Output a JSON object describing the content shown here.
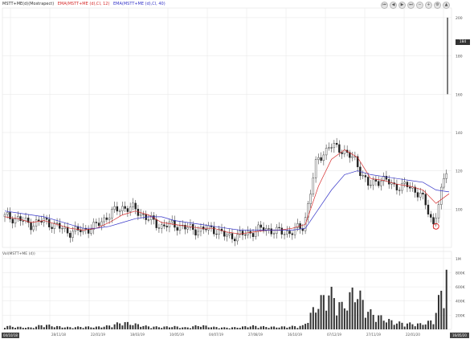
{
  "header": {
    "symbol_label": "MSTT+ME(d)(Mostrapect)",
    "ema_fast_label": "EMA(MSTT+ME (d),Cl, 12)",
    "ema_slow_label": "EMA(MSTT+ME (d),Cl, 40)"
  },
  "toolbar": {
    "buttons": [
      {
        "name": "first-icon",
        "glyph": "⏮"
      },
      {
        "name": "back-icon",
        "glyph": "◀"
      },
      {
        "name": "play-icon",
        "glyph": "▶"
      },
      {
        "name": "last-icon",
        "glyph": "⏭"
      },
      {
        "name": "zoom-out-icon",
        "glyph": "−"
      },
      {
        "name": "zoom-in-icon",
        "glyph": "+"
      },
      {
        "name": "settings-icon",
        "glyph": "⚙"
      },
      {
        "name": "up-icon",
        "glyph": "▲"
      }
    ]
  },
  "price_panel": {
    "current_price_label": "184",
    "date_start_label": "04/10/18",
    "date_end_label": "16/05/20",
    "marker": "circle"
  },
  "volume_panel": {
    "title": "Vol(MSTT+ME (d))"
  },
  "colors": {
    "candles": "#222222",
    "ema_fast": "#d62a2a",
    "ema_slow": "#3535c8",
    "volume_bars": "#333333",
    "grid": "#e6e6e6",
    "marker": "#e02020"
  },
  "chart_data": [
    {
      "type": "candlestick",
      "title": "MSTT+ME(d)",
      "x_ticks": [
        "04/10/18",
        "28/11/18",
        "22/01/19",
        "18/03/19",
        "10/05/19",
        "04/07/19",
        "27/08/19",
        "16/10/19",
        "07/12/19",
        "27/11/19",
        "22/01/20",
        "16/05/20"
      ],
      "y_ticks": [
        100,
        120,
        140,
        160,
        180,
        200
      ],
      "ylim": [
        80,
        205
      ],
      "series": [
        {
          "name": "EMA(MSTT+ME (d),Cl, 12)",
          "values": [
            96,
            95,
            93,
            94,
            92,
            90,
            89,
            90,
            93,
            97,
            99,
            97,
            93,
            92,
            91,
            90,
            90,
            88,
            87,
            88,
            89,
            89,
            90,
            92,
            112,
            126,
            131,
            127,
            116,
            115,
            113,
            112,
            110,
            103,
            108
          ]
        },
        {
          "name": "EMA(MSTT+ME (d),Cl, 40)",
          "values": [
            99,
            98,
            97,
            96,
            94,
            92,
            90,
            90,
            91,
            93,
            95,
            96,
            96,
            94,
            93,
            92,
            91,
            90,
            89,
            89,
            89,
            89,
            89,
            90,
            100,
            110,
            118,
            120,
            118,
            117,
            116,
            115,
            114,
            110,
            109
          ]
        }
      ],
      "close": [
        96,
        95,
        92,
        94,
        91,
        88,
        89,
        91,
        97,
        101,
        100,
        95,
        91,
        92,
        90,
        89,
        90,
        86,
        86,
        88,
        90,
        88,
        88,
        91,
        125,
        133,
        131,
        125,
        112,
        116,
        112,
        112,
        108,
        92,
        120
      ],
      "spike": {
        "high": 200,
        "low": 160
      }
    },
    {
      "type": "bar",
      "title": "Vol(MSTT+ME (d))",
      "y_ticks": [
        "200K",
        "400K",
        "600K",
        "800K",
        "1M"
      ],
      "ylim": [
        0,
        1100000
      ],
      "values": [
        60000,
        40000,
        30000,
        80000,
        50000,
        35000,
        45000,
        40000,
        60000,
        120000,
        90000,
        50000,
        40000,
        50000,
        30000,
        70000,
        40000,
        30000,
        35000,
        60000,
        45000,
        40000,
        50000,
        60000,
        420000,
        640000,
        380000,
        700000,
        300000,
        200000,
        120000,
        100000,
        90000,
        150000,
        1000000
      ]
    }
  ]
}
